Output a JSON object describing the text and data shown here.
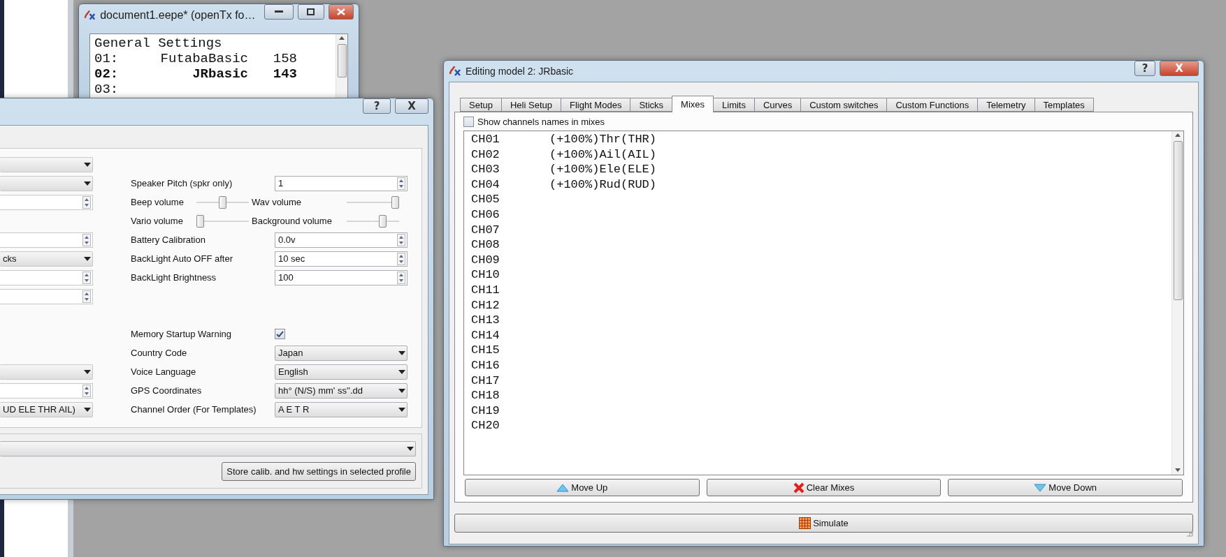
{
  "models_window": {
    "title": "document1.eepe* (openTx fo…",
    "header": "General Settings",
    "rows": [
      {
        "number": "01:",
        "name": "FutabaBasic",
        "size": "158",
        "selected": false
      },
      {
        "number": "02:",
        "name": "JRbasic",
        "size": "143",
        "selected": true
      },
      {
        "number": "03:",
        "selected": false
      }
    ]
  },
  "settings_dialog": {
    "help": "?",
    "close": "X",
    "rows": [
      {
        "left": {
          "kind": "combo"
        }
      },
      {
        "left": {
          "kind": "combo"
        },
        "right": {
          "kind": "spin",
          "label": "Speaker Pitch (spkr only)",
          "value": "1"
        }
      },
      {
        "left": {
          "kind": "spin"
        },
        "right": {
          "kind": "sliders",
          "sliders": [
            {
              "label": "Beep volume",
              "level": 0.5
            },
            {
              "label": "Wav volume",
              "level": 1
            }
          ]
        }
      },
      {
        "right": {
          "kind": "sliders",
          "sliders": [
            {
              "label": "Vario volume",
              "level": 0
            },
            {
              "label": "Background volume",
              "level": 0.72
            }
          ]
        }
      },
      {
        "left": {
          "kind": "spin"
        },
        "right": {
          "kind": "spin",
          "label": "Battery Calibration",
          "value": "0.0v"
        }
      },
      {
        "left": {
          "kind": "combo",
          "value": "cks"
        },
        "right": {
          "kind": "spin",
          "label": "BackLight  Auto OFF after",
          "value": "10 sec"
        }
      },
      {
        "left": {
          "kind": "spin"
        },
        "right": {
          "kind": "spin",
          "label": "BackLight Brightness",
          "value": "100"
        }
      },
      {
        "left": {
          "kind": "spin"
        }
      },
      {},
      {
        "right": {
          "kind": "check",
          "label": "Memory Startup Warning",
          "checked": true
        }
      },
      {
        "right": {
          "kind": "combo",
          "label": "Country Code",
          "value": "Japan"
        }
      },
      {
        "left": {
          "kind": "combo"
        },
        "right": {
          "kind": "combo",
          "label": "Voice Language",
          "value": "English"
        }
      },
      {
        "left": {
          "kind": "spin"
        },
        "right": {
          "kind": "combo",
          "label": "GPS Coordinates",
          "value": "hh°  (N/S) mm' ss''.dd"
        }
      },
      {
        "left": {
          "kind": "combo",
          "value": "UD ELE THR AIL)"
        },
        "right": {
          "kind": "combo",
          "label": "Channel Order (For Templates)",
          "value": "A E T R"
        }
      }
    ],
    "store_button": "Store calib. and hw settings in selected profile"
  },
  "editor_window": {
    "title": "Editing model 2: JRbasic",
    "help": "?",
    "close": "X",
    "tabs": [
      {
        "label": "Setup",
        "selected": false
      },
      {
        "label": "Heli Setup",
        "selected": false
      },
      {
        "label": "Flight Modes",
        "selected": false
      },
      {
        "label": "Sticks",
        "selected": false
      },
      {
        "label": "Mixes",
        "selected": true
      },
      {
        "label": "Limits",
        "selected": false
      },
      {
        "label": "Curves",
        "selected": false
      },
      {
        "label": "Custom switches",
        "selected": false
      },
      {
        "label": "Custom Functions",
        "selected": false
      },
      {
        "label": "Telemetry",
        "selected": false
      },
      {
        "label": "Templates",
        "selected": false
      }
    ],
    "show_names": {
      "label": "Show channels names in mixes",
      "checked": false
    },
    "channels": [
      {
        "channel": "CH01",
        "mix": "(+100%)Thr(THR)"
      },
      {
        "channel": "CH02",
        "mix": "(+100%)Ail(AIL)"
      },
      {
        "channel": "CH03",
        "mix": "(+100%)Ele(ELE)"
      },
      {
        "channel": "CH04",
        "mix": "(+100%)Rud(RUD)"
      },
      {
        "channel": "CH05"
      },
      {
        "channel": "CH06"
      },
      {
        "channel": "CH07"
      },
      {
        "channel": "CH08"
      },
      {
        "channel": "CH09"
      },
      {
        "channel": "CH10"
      },
      {
        "channel": "CH11"
      },
      {
        "channel": "CH12"
      },
      {
        "channel": "CH13"
      },
      {
        "channel": "CH14"
      },
      {
        "channel": "CH15"
      },
      {
        "channel": "CH16"
      },
      {
        "channel": "CH17"
      },
      {
        "channel": "CH18"
      },
      {
        "channel": "CH19"
      },
      {
        "channel": "CH20"
      }
    ],
    "buttons": [
      {
        "kind": "up",
        "label": "Move Up"
      },
      {
        "kind": "clear",
        "label": "Clear Mixes"
      },
      {
        "kind": "down",
        "label": "Move Down"
      }
    ],
    "simulate": "Simulate"
  }
}
